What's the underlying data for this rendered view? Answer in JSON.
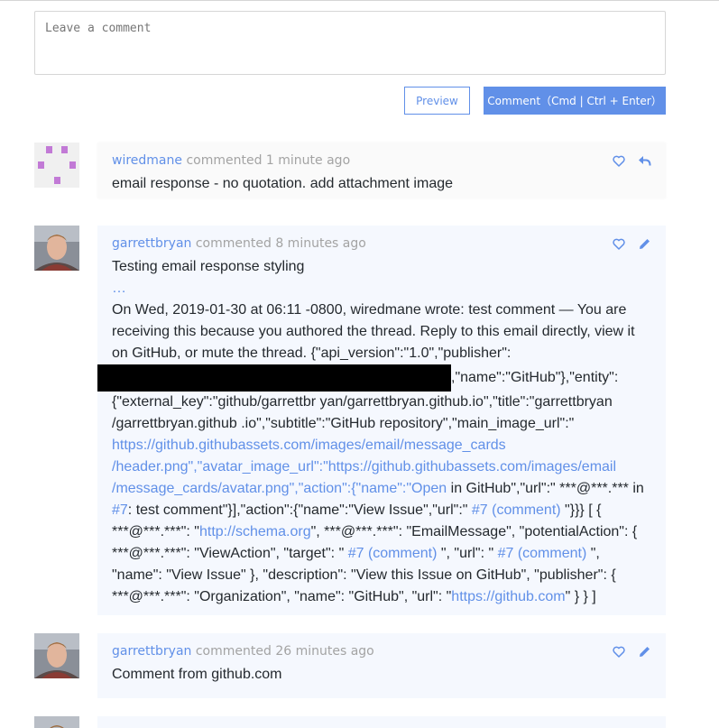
{
  "editor": {
    "placeholder": "Leave a comment",
    "preview_label": "Preview",
    "submit_label": "Comment（Cmd | Ctrl + Enter）"
  },
  "colors": {
    "accent": "#6190e8",
    "muted": "#a3a3a3",
    "identicon": "#c27ad6"
  },
  "comments": [
    {
      "user": "wiredmane",
      "verb": "commented",
      "time": "1 minute ago",
      "body": "email response - no quotation. add attachment image",
      "actions": [
        "heart-icon",
        "reply-icon"
      ]
    },
    {
      "user": "garrettbryan",
      "verb": "commented",
      "time": "8 minutes ago",
      "body": "Testing email response styling",
      "ellipsis": "…",
      "quote": {
        "t1": "On Wed, 2019-01-30 at 06:11 -0800, wiredmane wrote: test comment — You are receiving this because you authored the thread. Reply to this email directly, view it on GitHub, or mute the thread. {\"api_version\":\"1.0\",\"publisher\":",
        "t2": ",\"name\":\"GitHub\"},\"entity\": {\"external_key\":\"github/garrettbr yan/garrettbryan.github.io\",\"title\":\"garrettbryan /garrettbryan.github .io\",\"subtitle\":\"GitHub repository\",\"main_image_url\":\"",
        "l1": "https://github.githubassets.com/images/email/message_cards /header.png\",\"avatar_image_url\":\"https://github.githubassets.com/images/email /message_cards/avatar.png\",\"action\":{\"name\":\"Open",
        "t3": " in GitHub\",\"url\":\" ***@***.*** in ",
        "l2": "#7",
        "t4": ": test comment\"}],\"action\":{\"name\":\"View Issue\",\"url\":\" ",
        "l3": "#7 (comment)",
        "t5": " \"}}} [ { ***@***.***\": \"",
        "l4": "http://schema.org",
        "t6": "\", ***@***.***\": \"EmailMessage\", \"potentialAction\": { ***@***.***\": \"ViewAction\", \"target\": \" ",
        "l5": "#7 (comment)",
        "t7": " \", \"url\": \" ",
        "l6": "#7 (comment)",
        "t8": " \", \"name\": \"View Issue\" }, \"description\": \"View this Issue on GitHub\", \"publisher\": { ***@***.***\": \"Organization\", \"name\": \"GitHub\", \"url\": \"",
        "l7": "https://github.com",
        "t9": "\" } } ]"
      },
      "actions": [
        "heart-icon",
        "pencil-icon"
      ]
    },
    {
      "user": "garrettbryan",
      "verb": "commented",
      "time": "26 minutes ago",
      "body": "Comment from github.com",
      "actions": [
        "heart-icon",
        "pencil-icon"
      ]
    }
  ]
}
